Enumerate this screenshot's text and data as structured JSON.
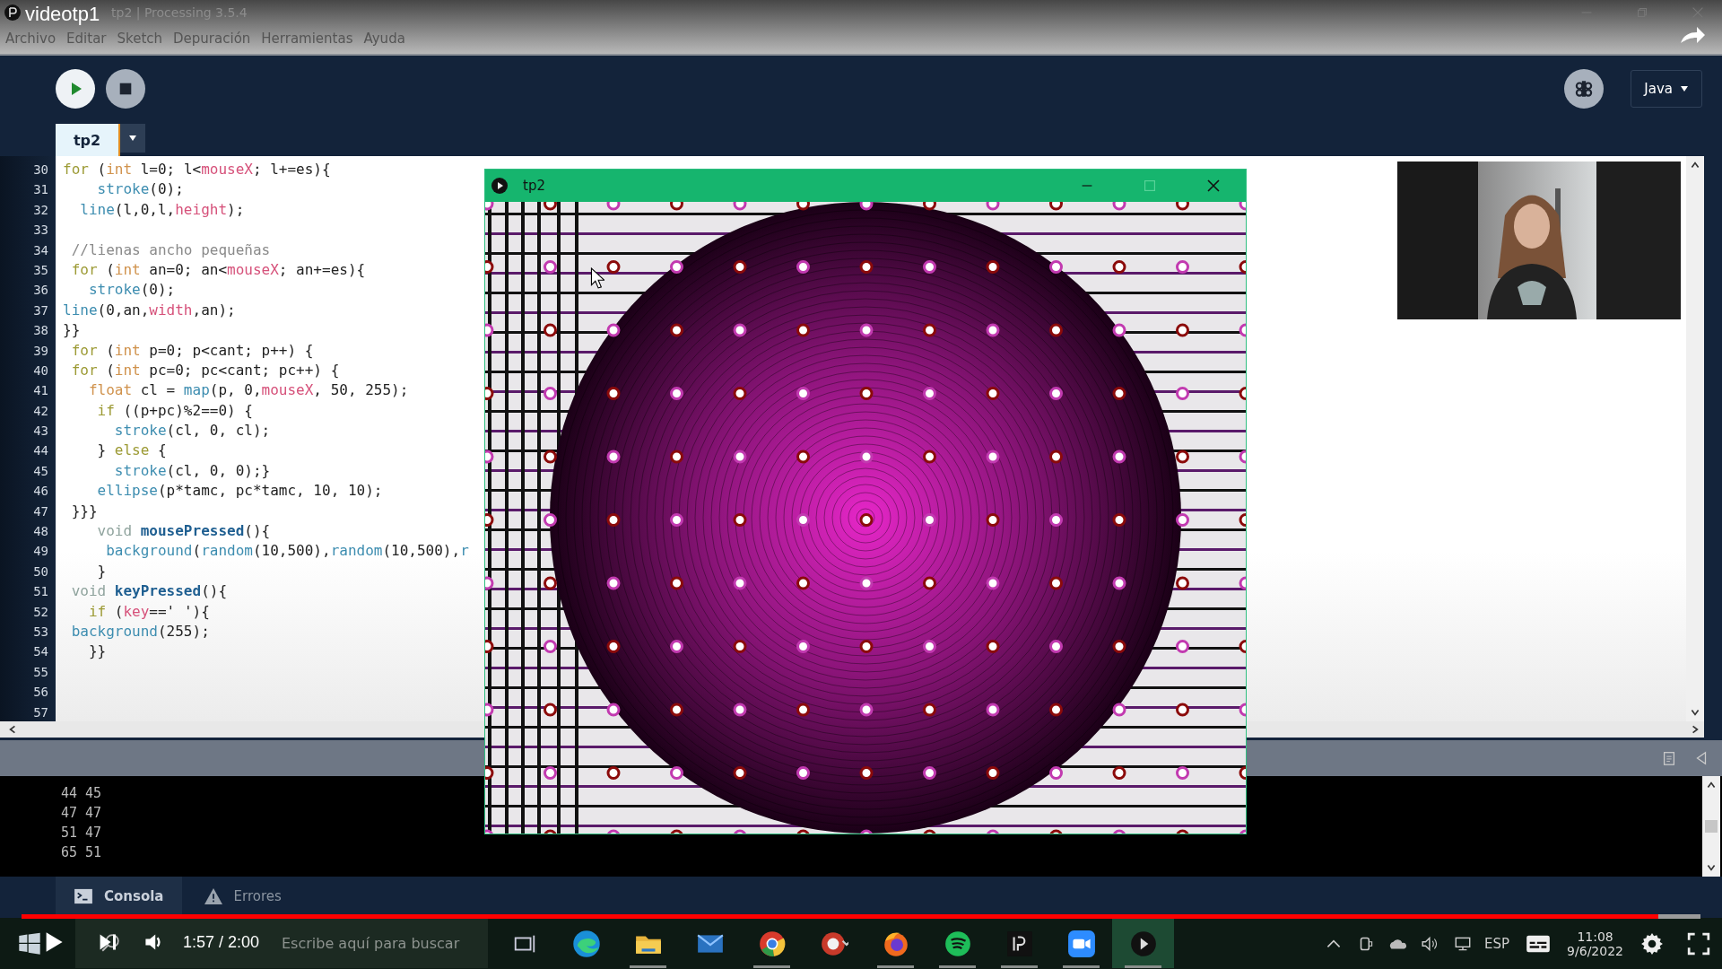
{
  "video": {
    "title": "videotp1",
    "time": "1:57 / 2:00",
    "progress": {
      "level": 0.975
    }
  },
  "window": {
    "title": "tp2 | Processing 3.5.4"
  },
  "menu": [
    "Archivo",
    "Editar",
    "Sketch",
    "Depuración",
    "Herramientas",
    "Ayuda"
  ],
  "toolbar": {
    "mode": "Java"
  },
  "tabs": [
    {
      "label": "tp2",
      "selected": true
    }
  ],
  "editor": {
    "lines": [
      {
        "number": "30",
        "tokens": [
          {
            "text": "for",
            "kind": "control"
          },
          {
            "text": " (",
            "kind": "plain"
          },
          {
            "text": "int",
            "kind": "type"
          },
          {
            "text": " l=0; l<",
            "kind": "plain"
          },
          {
            "text": "mouseX",
            "kind": "var"
          },
          {
            "text": "; l+=es){",
            "kind": "plain"
          }
        ]
      },
      {
        "number": "31",
        "tokens": [
          {
            "text": "    stroke",
            "kind": "func"
          },
          {
            "text": "(0);",
            "kind": "plain"
          }
        ]
      },
      {
        "number": "32",
        "tokens": [
          {
            "text": "  line",
            "kind": "func"
          },
          {
            "text": "(l,0,l,",
            "kind": "plain"
          },
          {
            "text": "height",
            "kind": "var"
          },
          {
            "text": ");",
            "kind": "plain"
          }
        ]
      },
      {
        "number": "33"
      },
      {
        "number": "34",
        "tokens": [
          {
            "text": " //lienas ancho pequeñas",
            "kind": "comment"
          }
        ]
      },
      {
        "number": "35",
        "tokens": [
          {
            "text": " for",
            "kind": "control"
          },
          {
            "text": " (",
            "kind": "plain"
          },
          {
            "text": "int",
            "kind": "type"
          },
          {
            "text": " an=0; an<",
            "kind": "plain"
          },
          {
            "text": "mouseX",
            "kind": "var"
          },
          {
            "text": "; an+=es){",
            "kind": "plain"
          }
        ]
      },
      {
        "number": "36",
        "tokens": [
          {
            "text": "   stroke",
            "kind": "func"
          },
          {
            "text": "(0);",
            "kind": "plain"
          }
        ]
      },
      {
        "number": "37",
        "tokens": [
          {
            "text": "line",
            "kind": "func"
          },
          {
            "text": "(0,an,",
            "kind": "plain"
          },
          {
            "text": "width",
            "kind": "var"
          },
          {
            "text": ",an);",
            "kind": "plain"
          }
        ]
      },
      {
        "number": "38",
        "tokens": [
          {
            "text": "}}",
            "kind": "plain"
          }
        ]
      },
      {
        "number": "39",
        "tokens": [
          {
            "text": " for",
            "kind": "control"
          },
          {
            "text": " (",
            "kind": "plain"
          },
          {
            "text": "int",
            "kind": "type"
          },
          {
            "text": " p=0; p<cant; p++) {",
            "kind": "plain"
          }
        ]
      },
      {
        "number": "40",
        "tokens": [
          {
            "text": " for",
            "kind": "control"
          },
          {
            "text": " (",
            "kind": "plain"
          },
          {
            "text": "int",
            "kind": "type"
          },
          {
            "text": " pc=0; pc<cant; pc++) {",
            "kind": "plain"
          }
        ]
      },
      {
        "number": "41",
        "tokens": [
          {
            "text": "   float",
            "kind": "type"
          },
          {
            "text": " cl = ",
            "kind": "plain"
          },
          {
            "text": "map",
            "kind": "func"
          },
          {
            "text": "(p, 0,",
            "kind": "plain"
          },
          {
            "text": "mouseX",
            "kind": "var"
          },
          {
            "text": ", 50, 255);",
            "kind": "plain"
          }
        ]
      },
      {
        "number": "42",
        "tokens": [
          {
            "text": "    if",
            "kind": "control"
          },
          {
            "text": " ((p+pc)%2==0) {",
            "kind": "plain"
          }
        ]
      },
      {
        "number": "43",
        "tokens": [
          {
            "text": "      stroke",
            "kind": "func"
          },
          {
            "text": "(cl, 0, cl);",
            "kind": "plain"
          }
        ]
      },
      {
        "number": "44",
        "tokens": [
          {
            "text": "    } ",
            "kind": "plain"
          },
          {
            "text": "else",
            "kind": "control"
          },
          {
            "text": " {",
            "kind": "plain"
          }
        ]
      },
      {
        "number": "45",
        "tokens": [
          {
            "text": "      stroke",
            "kind": "func"
          },
          {
            "text": "(cl, 0, 0);}",
            "kind": "plain"
          }
        ]
      },
      {
        "number": "46",
        "tokens": [
          {
            "text": "    ellipse",
            "kind": "func"
          },
          {
            "text": "(p*tamc, pc*tamc, 10, 10);",
            "kind": "plain"
          }
        ]
      },
      {
        "number": "47",
        "tokens": [
          {
            "text": " }}}",
            "kind": "plain"
          }
        ]
      },
      {
        "number": "48",
        "tokens": [
          {
            "text": "    void ",
            "kind": "void"
          },
          {
            "text": "mousePressed",
            "kind": "decl"
          },
          {
            "text": "(){",
            "kind": "plain"
          }
        ]
      },
      {
        "number": "49",
        "tokens": [
          {
            "text": "     background",
            "kind": "func"
          },
          {
            "text": "(",
            "kind": "plain"
          },
          {
            "text": "random",
            "kind": "func"
          },
          {
            "text": "(10,500),",
            "kind": "plain"
          },
          {
            "text": "random",
            "kind": "func"
          },
          {
            "text": "(10,500),",
            "kind": "plain"
          },
          {
            "text": "r",
            "kind": "func"
          }
        ]
      },
      {
        "number": "50",
        "tokens": [
          {
            "text": "    }",
            "kind": "plain"
          }
        ]
      },
      {
        "number": "51",
        "tokens": [
          {
            "text": " void ",
            "kind": "void"
          },
          {
            "text": "keyPressed",
            "kind": "decl"
          },
          {
            "text": "(){",
            "kind": "plain"
          }
        ]
      },
      {
        "number": "52",
        "tokens": [
          {
            "text": "   if",
            "kind": "control"
          },
          {
            "text": " (",
            "kind": "plain"
          },
          {
            "text": "key",
            "kind": "var"
          },
          {
            "text": "==' '){",
            "kind": "plain"
          }
        ]
      },
      {
        "number": "53",
        "tokens": [
          {
            "text": " background",
            "kind": "func"
          },
          {
            "text": "(255);",
            "kind": "plain"
          }
        ]
      },
      {
        "number": "54",
        "tokens": [
          {
            "text": "   }}",
            "kind": "plain"
          }
        ]
      },
      {
        "number": "55"
      },
      {
        "number": "56"
      },
      {
        "number": "57"
      }
    ]
  },
  "sketch_window": {
    "title": "tp2"
  },
  "console": {
    "lines": [
      "44 45",
      "47 47",
      "51 47",
      "65 51"
    ]
  },
  "console_tabs": [
    {
      "label": "Consola",
      "selected": true
    },
    {
      "label": "Errores",
      "selected": false
    }
  ],
  "taskbar": {
    "search_placeholder": "Escribe aquí para buscar",
    "apps": [
      {
        "kind": "taskview",
        "running": false,
        "selected": false
      },
      {
        "kind": "edge",
        "running": false,
        "selected": false
      },
      {
        "kind": "files",
        "running": true,
        "selected": false
      },
      {
        "kind": "mail",
        "running": false,
        "selected": false
      },
      {
        "kind": "chrome",
        "running": true,
        "selected": false
      },
      {
        "kind": "tool",
        "running": false,
        "selected": false
      },
      {
        "kind": "firefox",
        "running": true,
        "selected": false
      },
      {
        "kind": "spotify",
        "running": true,
        "selected": false
      },
      {
        "kind": "processing",
        "running": true,
        "selected": false
      },
      {
        "kind": "zoom",
        "running": true,
        "selected": false
      },
      {
        "kind": "player",
        "running": true,
        "selected": true
      }
    ],
    "language": "ESP",
    "time": "11:08",
    "date": "9/6/2022"
  }
}
